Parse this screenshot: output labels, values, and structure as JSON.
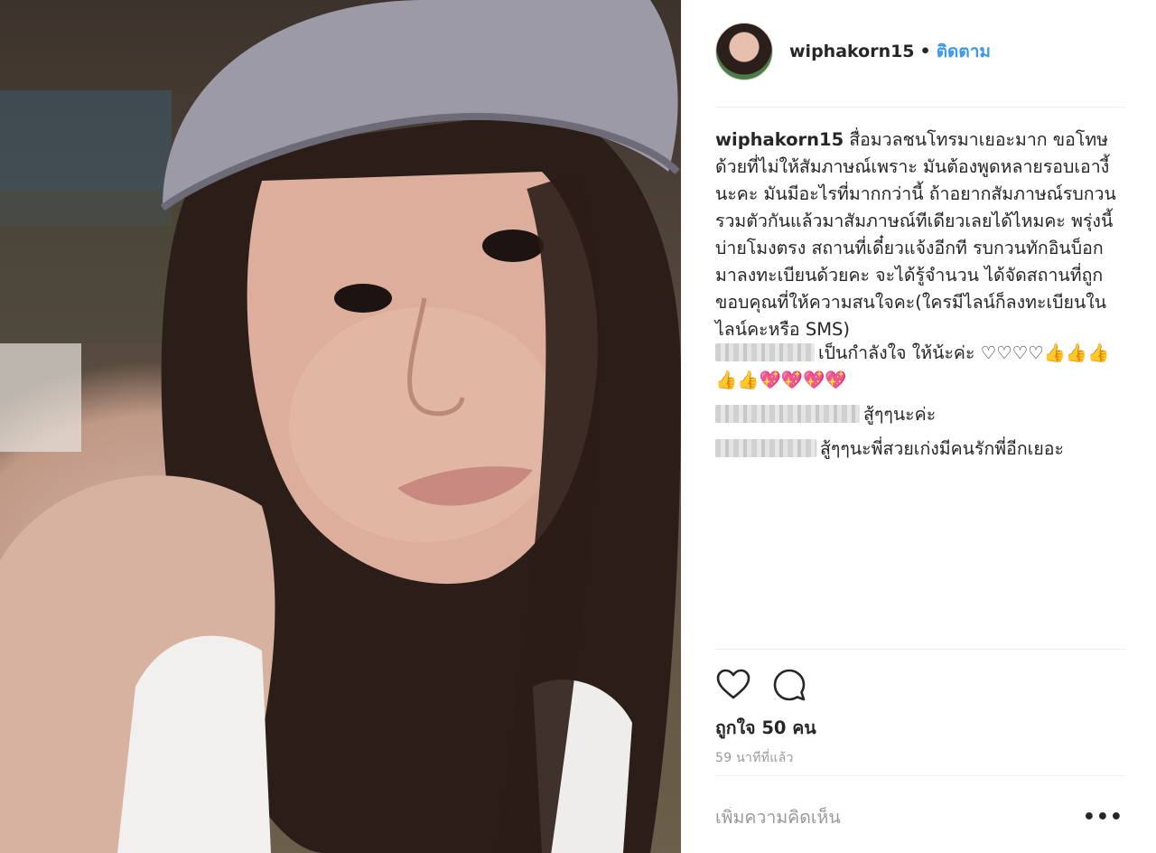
{
  "post": {
    "username": "wiphakorn15",
    "separator": "•",
    "follow_label": "ติดตาม",
    "caption_author": "wiphakorn15",
    "caption_text": "สื่อมวลชนโทรมาเยอะมาก ขอโทษด้วยที่ไม่ให้สัมภาษณ์เพราะ มันต้องพูดหลายรอบเอางี้นะคะ มันมีอะไรที่มากกว่านี้ ถ้าอยากสัมภาษณ์รบกวนรวมตัวกันแล้วมาสัมภาษณ์ทีเดียวเลยได้ไหมคะ พรุ่งนี้ บ่ายโมงตรง สถานที่เดี๋ยวแจ้งอีกที รบกวนทักอินบ็อกมาลงทะเบียนด้วยคะ จะได้รู้จำนวน ได้จัดสถานที่ถูก ขอบคุณที่ให้ความสนใจคะ(ใครมีไลน์ก็ลงทะเบียนในไลน์คะหรือ SMS)"
  },
  "comments": [
    {
      "text": "เป็นกำลังใจ ให้น้ะค่ะ ♡♡♡♡👍👍👍👍👍💖💖💖💖"
    },
    {
      "text": "สู้ๆๆนะค่ะ"
    },
    {
      "text": "สู้ๆๆนะพี่สวยเก่งมีคนรักพี่อีกเยอะ"
    }
  ],
  "likes_text": "ถูกใจ 50 คน",
  "time_text": "59 นาทีที่แล้ว",
  "add_comment_placeholder": "เพิ่มความคิดเห็น",
  "more_label": "•••",
  "colors": {
    "link": "#3897f0",
    "text": "#262626",
    "muted": "#999999",
    "divider": "#efefef"
  },
  "icons": [
    "heart-icon",
    "comment-icon",
    "more-options-icon"
  ]
}
